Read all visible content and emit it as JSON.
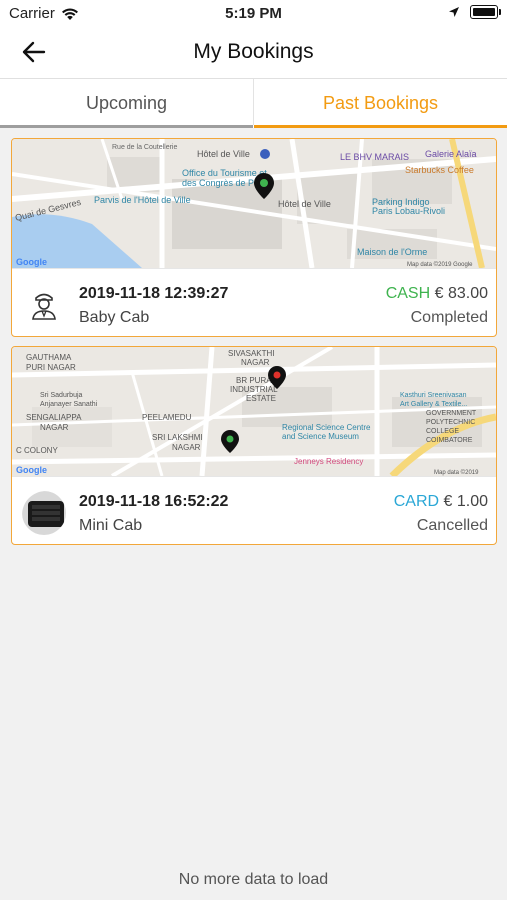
{
  "status_bar": {
    "carrier": "Carrier",
    "time": "5:19 PM"
  },
  "header": {
    "title": "My Bookings"
  },
  "tabs": [
    {
      "label": "Upcoming",
      "active": false
    },
    {
      "label": "Past Bookings",
      "active": true
    }
  ],
  "colors": {
    "accent": "#f29b12",
    "cash": "#3fb34f",
    "card": "#2aa7d6"
  },
  "bookings": [
    {
      "datetime": "2019-11-18 12:39:27",
      "cab_type": "Baby Cab",
      "payment_mode": "CASH",
      "amount": "€ 83.00",
      "status": "Completed",
      "map": {
        "labels": [
          "Rue de la Coutellerie",
          "Hôtel de Ville",
          "LE BHV MARAIS",
          "Galerie Alaïa",
          "Office du Tourisme et",
          "des Congrès de Paris",
          "Starbucks Coffee",
          "Parvis de l'Hôtel de Ville",
          "Hôtel de Ville",
          "Parking Indigo",
          "Paris Lobau-Rivoli",
          "Quai de Gesvres",
          "Maison de l'Orme",
          "Google",
          "Map data ©2019 Google"
        ]
      }
    },
    {
      "datetime": "2019-11-18 16:52:22",
      "cab_type": "Mini Cab",
      "payment_mode": "CARD",
      "amount": "€ 1.00",
      "status": "Cancelled",
      "map": {
        "labels": [
          "GAUTHAMA",
          "PURI NAGAR",
          "SIVASAKTHI",
          "NAGAR",
          "BR PURAM",
          "INDUSTRIAL",
          "ESTATE",
          "Sri Sadurbuja",
          "Anjanayer Sanathi",
          "SENGALIAPPA",
          "NAGAR",
          "PEELAMEDU",
          "Kasthuri Sreenivasan",
          "Art Gallery & Textile...",
          "GOVERNMENT",
          "POLYTECHNIC",
          "COLLEGE",
          "COIMBATORE",
          "Regional Science Centre",
          "and Science Museum",
          "SRI LAKSHMI",
          "NAGAR",
          "C COLONY",
          "Jenneys Residency",
          "Google",
          "Map data ©2019"
        ]
      }
    }
  ],
  "footer": {
    "message": "No more data to load"
  }
}
